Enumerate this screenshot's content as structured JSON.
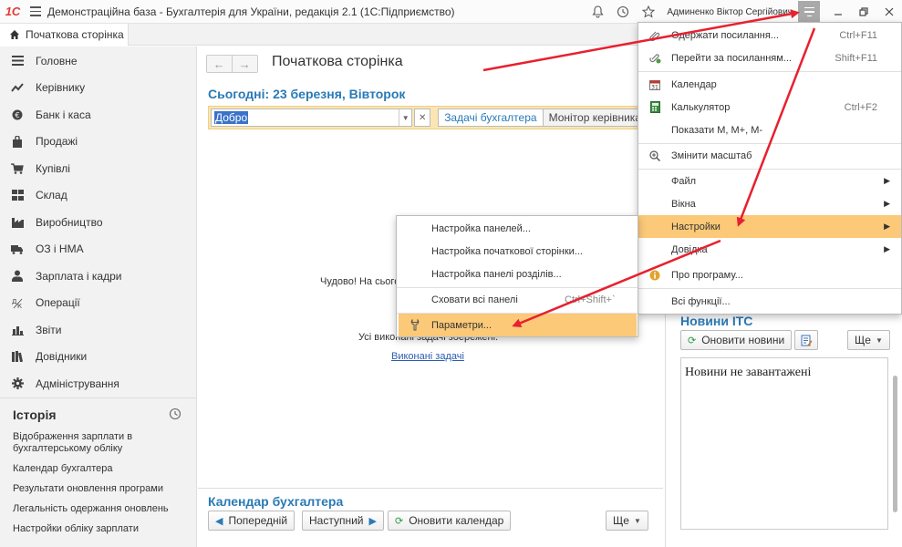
{
  "window": {
    "logo": "1С",
    "title": "Демонстраційна база - Бухгалтерія для України, редакція 2.1  (1С:Підприємство)",
    "user": "Админенко Віктор Сергійович"
  },
  "tabs": {
    "home": "Початкова сторінка"
  },
  "sidebar": {
    "items": [
      {
        "label": "Головне",
        "icon": "list-icon"
      },
      {
        "label": "Керівнику",
        "icon": "trend-icon"
      },
      {
        "label": "Банк і каса",
        "icon": "coin-icon"
      },
      {
        "label": "Продажі",
        "icon": "bag-icon"
      },
      {
        "label": "Купівлі",
        "icon": "cart-icon"
      },
      {
        "label": "Склад",
        "icon": "grid-icon"
      },
      {
        "label": "Виробництво",
        "icon": "factory-icon"
      },
      {
        "label": "ОЗ і НМА",
        "icon": "truck-icon"
      },
      {
        "label": "Зарплата і кадри",
        "icon": "person-icon"
      },
      {
        "label": "Операції",
        "icon": "operations-icon"
      },
      {
        "label": "Звіти",
        "icon": "bar-chart-icon"
      },
      {
        "label": "Довідники",
        "icon": "books-icon"
      },
      {
        "label": "Адміністрування",
        "icon": "gear-icon"
      }
    ],
    "history": {
      "title": "Історія",
      "items": [
        "Відображення зарплати в бухгалтерському обліку",
        "Календар бухгалтера",
        "Результати оновлення програми",
        "Легальність одержання оновлень",
        "Настройки обліку зарплати"
      ]
    }
  },
  "main": {
    "page_title": "Початкова сторінка",
    "today": "Сьогодні: 23 березня, Вівторок",
    "filter_value": "Добро",
    "tab_tasks": "Задачі бухгалтера",
    "tab_monitor": "Монітор керівника",
    "status_text": "Чудово! На сьогод",
    "saved_text": "Усі виконані задачі збережені.",
    "done_link": "Виконані задачі",
    "calendar": {
      "title": "Календар бухгалтера",
      "prev": "Попередній",
      "next": "Наступний",
      "refresh": "Оновити календар",
      "more": "Ще"
    }
  },
  "news": {
    "title": "Новини ІТС",
    "refresh": "Оновити новини",
    "more": "Ще",
    "text": "Новини не завантажені"
  },
  "main_menu": {
    "items": [
      {
        "label": "Одержати посилання...",
        "shortcut": "Ctrl+F11",
        "icon": "paperclip-icon"
      },
      {
        "label": "Перейти за посиланням...",
        "shortcut": "Shift+F11",
        "icon": "link-go-icon"
      },
      {
        "label": "Календар",
        "shortcut": "",
        "icon": "calendar-icon"
      },
      {
        "label": "Калькулятор",
        "shortcut": "Ctrl+F2",
        "icon": "calculator-icon"
      },
      {
        "label": "Показати М, М+, М-",
        "shortcut": "",
        "icon": ""
      },
      {
        "label": "Змінити масштаб",
        "shortcut": "",
        "icon": "zoom-icon"
      },
      {
        "label": "Файл",
        "shortcut": "",
        "icon": ""
      },
      {
        "label": "Вікна",
        "shortcut": "",
        "icon": ""
      },
      {
        "label": "Настройки",
        "shortcut": "",
        "icon": ""
      },
      {
        "label": "Довідка",
        "shortcut": "",
        "icon": ""
      },
      {
        "label": "Про програму...",
        "shortcut": "",
        "icon": "info-icon"
      },
      {
        "label": "Всі функції...",
        "shortcut": "",
        "icon": ""
      }
    ]
  },
  "sub_menu": {
    "items": [
      {
        "label": "Настройка панелей...",
        "shortcut": ""
      },
      {
        "label": "Настройка початкової сторінки...",
        "shortcut": ""
      },
      {
        "label": "Настройка панелі розділів...",
        "shortcut": ""
      },
      {
        "label": "Сховати всі панелі",
        "shortcut": "Ctrl+Shift+`"
      },
      {
        "label": "Параметри...",
        "shortcut": ""
      }
    ]
  },
  "colors": {
    "accent_blue": "#2a7ab5",
    "highlight": "#fbc978",
    "arrow_red": "#e8202f"
  }
}
